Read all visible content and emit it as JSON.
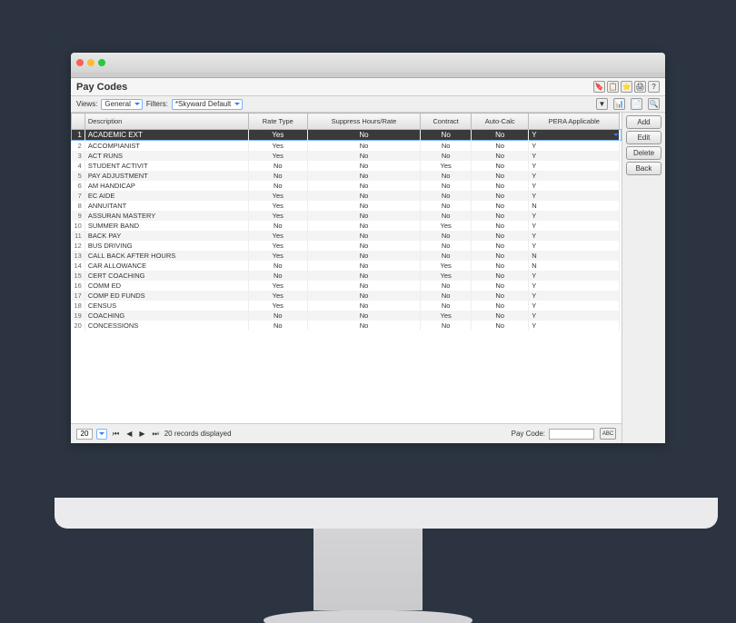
{
  "title": "Pay Codes",
  "toolbar": {
    "views_label": "Views:",
    "views_value": "General",
    "filters_label": "Filters:",
    "filters_value": "*Skyward Default"
  },
  "columns": {
    "row": "",
    "desc": "Description",
    "rate": "Rate Type",
    "suppress": "Suppress Hours/Rate",
    "contract": "Contract",
    "autocalc": "Auto-Calc",
    "pera": "PERA Applicable"
  },
  "rows": [
    {
      "n": 1,
      "desc": "ACADEMIC EXT",
      "rate": "Yes",
      "suppress": "No",
      "contract": "No",
      "autocalc": "No",
      "pera": "Y",
      "sel": true
    },
    {
      "n": 2,
      "desc": "ACCOMPIANIST",
      "rate": "Yes",
      "suppress": "No",
      "contract": "No",
      "autocalc": "No",
      "pera": "Y"
    },
    {
      "n": 3,
      "desc": "ACT RUNS",
      "rate": "Yes",
      "suppress": "No",
      "contract": "No",
      "autocalc": "No",
      "pera": "Y"
    },
    {
      "n": 4,
      "desc": "STUDENT ACTIVIT",
      "rate": "No",
      "suppress": "No",
      "contract": "Yes",
      "autocalc": "No",
      "pera": "Y"
    },
    {
      "n": 5,
      "desc": "PAY ADJUSTMENT",
      "rate": "No",
      "suppress": "No",
      "contract": "No",
      "autocalc": "No",
      "pera": "Y"
    },
    {
      "n": 6,
      "desc": "AM HANDICAP",
      "rate": "No",
      "suppress": "No",
      "contract": "No",
      "autocalc": "No",
      "pera": "Y"
    },
    {
      "n": 7,
      "desc": "EC AIDE",
      "rate": "Yes",
      "suppress": "No",
      "contract": "No",
      "autocalc": "No",
      "pera": "Y"
    },
    {
      "n": 8,
      "desc": "ANNUITANT",
      "rate": "Yes",
      "suppress": "No",
      "contract": "No",
      "autocalc": "No",
      "pera": "N"
    },
    {
      "n": 9,
      "desc": "ASSURAN MASTERY",
      "rate": "Yes",
      "suppress": "No",
      "contract": "No",
      "autocalc": "No",
      "pera": "Y"
    },
    {
      "n": 10,
      "desc": "SUMMER BAND",
      "rate": "No",
      "suppress": "No",
      "contract": "Yes",
      "autocalc": "No",
      "pera": "Y"
    },
    {
      "n": 11,
      "desc": "BACK PAY",
      "rate": "Yes",
      "suppress": "No",
      "contract": "No",
      "autocalc": "No",
      "pera": "Y"
    },
    {
      "n": 12,
      "desc": "BUS DRIVING",
      "rate": "Yes",
      "suppress": "No",
      "contract": "No",
      "autocalc": "No",
      "pera": "Y"
    },
    {
      "n": 13,
      "desc": "CALL BACK AFTER HOURS",
      "rate": "Yes",
      "suppress": "No",
      "contract": "No",
      "autocalc": "No",
      "pera": "N"
    },
    {
      "n": 14,
      "desc": "CAR ALLOWANCE",
      "rate": "No",
      "suppress": "No",
      "contract": "Yes",
      "autocalc": "No",
      "pera": "N"
    },
    {
      "n": 15,
      "desc": "CERT COACHING",
      "rate": "No",
      "suppress": "No",
      "contract": "Yes",
      "autocalc": "No",
      "pera": "Y"
    },
    {
      "n": 16,
      "desc": "COMM ED",
      "rate": "Yes",
      "suppress": "No",
      "contract": "No",
      "autocalc": "No",
      "pera": "Y"
    },
    {
      "n": 17,
      "desc": "COMP ED FUNDS",
      "rate": "Yes",
      "suppress": "No",
      "contract": "No",
      "autocalc": "No",
      "pera": "Y"
    },
    {
      "n": 18,
      "desc": "CENSUS",
      "rate": "Yes",
      "suppress": "No",
      "contract": "No",
      "autocalc": "No",
      "pera": "Y"
    },
    {
      "n": 19,
      "desc": "COACHING",
      "rate": "No",
      "suppress": "No",
      "contract": "Yes",
      "autocalc": "No",
      "pera": "Y"
    },
    {
      "n": 20,
      "desc": "CONCESSIONS",
      "rate": "No",
      "suppress": "No",
      "contract": "No",
      "autocalc": "No",
      "pera": "Y"
    }
  ],
  "buttons": {
    "add": "Add",
    "edit": "Edit",
    "delete": "Delete",
    "back": "Back"
  },
  "footer": {
    "page_size": "20",
    "status": "20 records displayed",
    "search_label": "Pay Code:",
    "abc": "ABC"
  }
}
